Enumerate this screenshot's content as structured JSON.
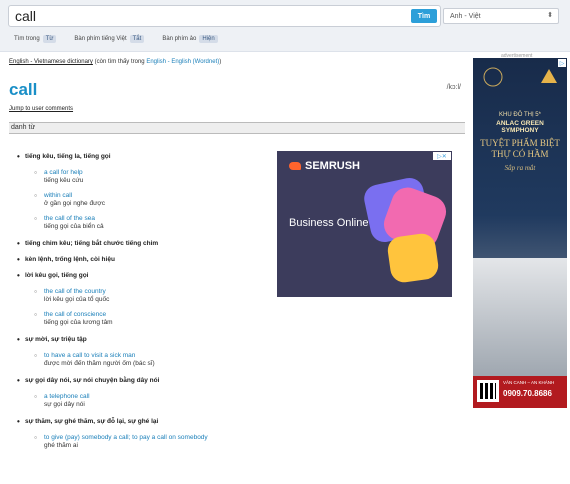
{
  "search": {
    "value": "call",
    "button_label": "Tìm",
    "language": "Anh - Việt"
  },
  "options": [
    {
      "label": "Tìm trong",
      "value": "Từ"
    },
    {
      "label": "Bàn phím tiếng Việt",
      "value": "Tắt"
    },
    {
      "label": "Bàn phím ảo",
      "value": "Hiện"
    }
  ],
  "advertisement_label": "advertisement",
  "source": {
    "dictionary": "English - Vietnamese dictionary",
    "also_in": "(còn tìm thấy trong",
    "alt_dictionary": "English - English (Wordnet)",
    "close": ")"
  },
  "entry": {
    "headword": "call",
    "phonetic": "/kɔ:l/",
    "jump_link": "Jump to user comments",
    "pos": "danh từ"
  },
  "senses": [
    {
      "meaning": "tiếng kêu, tiếng la, tiếng gọi",
      "examples": [
        {
          "en": "a call for help",
          "vi": "tiếng kêu cứu"
        },
        {
          "en": "within call",
          "vi": "ở gần gọi nghe được"
        },
        {
          "en": "the call of the sea",
          "vi": "tiếng gọi của biển cả"
        }
      ]
    },
    {
      "meaning": "tiếng chim kêu; tiếng bắt chước tiếng chim",
      "examples": []
    },
    {
      "meaning": "kèn lệnh, trống lệnh, còi hiệu",
      "examples": []
    },
    {
      "meaning": "lời kêu gọi, tiếng gọi",
      "examples": [
        {
          "en": "the call of the country",
          "vi": "lời kêu gọi của tổ quốc"
        },
        {
          "en": "the call of conscience",
          "vi": "tiếng gọi của lương tâm"
        }
      ]
    },
    {
      "meaning": "sự mời, sự triệu tập",
      "examples": [
        {
          "en": "to have a call to visit a sick man",
          "vi": "được mời đến thăm người ốm (bác sĩ)"
        }
      ]
    },
    {
      "meaning": "sự gọi dây nói, sự nói chuyện bằng dây nói",
      "examples": [
        {
          "en": "a telephone call",
          "vi": "sự gọi dây nói"
        }
      ]
    },
    {
      "meaning": "sự thăm, sự ghé thăm, sự đỗ lại, sự ghé lại",
      "examples": [
        {
          "en": "to give (pay) somebody a call; to pay a call on somebody",
          "vi": "ghé thăm ai"
        }
      ]
    }
  ],
  "ads": {
    "semrush": {
      "brand": "SEMRUSH",
      "text": "Business Online"
    },
    "tall": {
      "line1": "KHU ĐÔ THỊ 5*",
      "line2": "ANLAC GREEN SYMPHONY",
      "line3": "TUYỆT PHẨM BIỆT THỰ CÓ HẦM",
      "line4": "Sắp ra mắt",
      "footer_small": "VĂN CANH – AN KHÁNH",
      "phone": "0909.70.8686"
    }
  }
}
